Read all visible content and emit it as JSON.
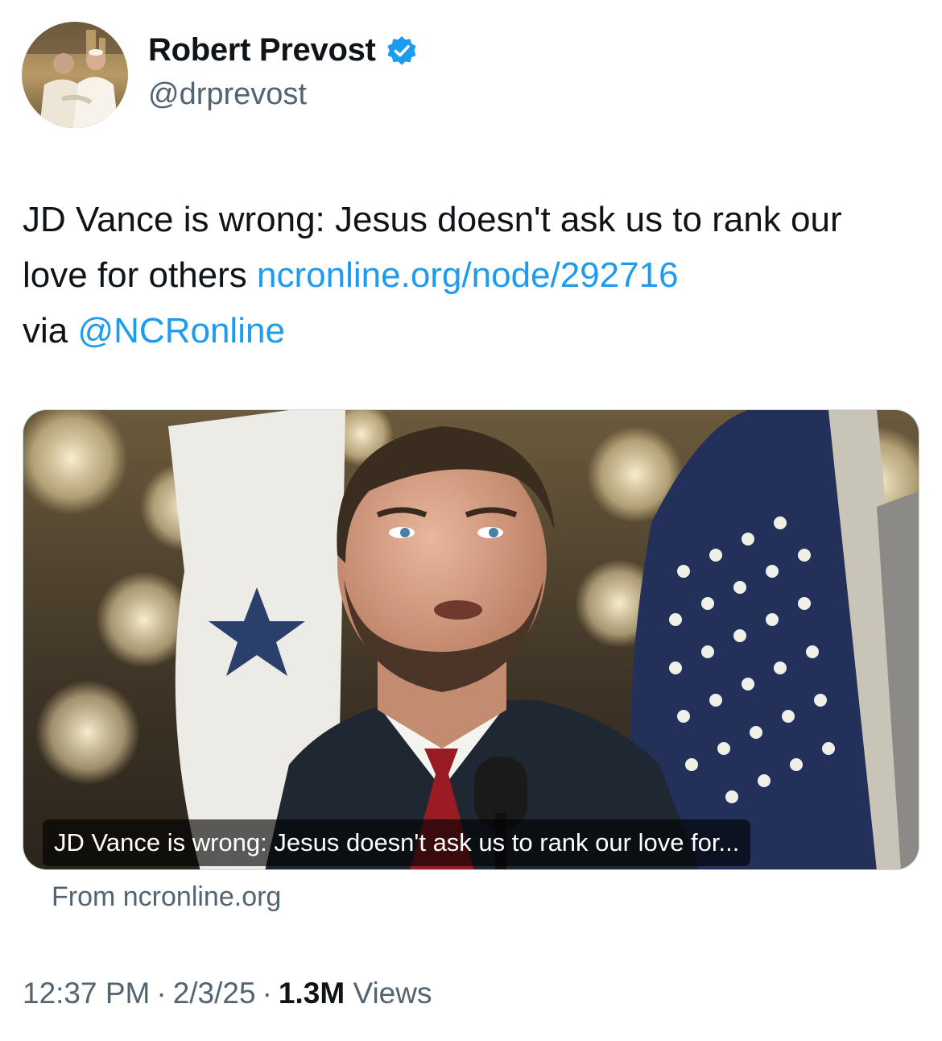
{
  "author": {
    "display_name": "Robert Prevost",
    "handle": "@drprevost",
    "verified_color": "#1d9bf0",
    "avatar_icon": "avatar-photo"
  },
  "tweet": {
    "text_before_link": "JD Vance is wrong: Jesus doesn't ask us to rank our love for others ",
    "link_text": "ncronline.org/node/292716",
    "via_text": "via ",
    "mention_text": "@NCRonline",
    "link_color": "#1d9bf0"
  },
  "card": {
    "caption": "JD Vance is wrong: Jesus doesn't ask us to rank our love for...",
    "source": "From ncronline.org"
  },
  "meta": {
    "time": "12:37 PM",
    "separator": "·",
    "date": "2/3/25",
    "views_count": "1.3M",
    "views_label": "Views"
  }
}
